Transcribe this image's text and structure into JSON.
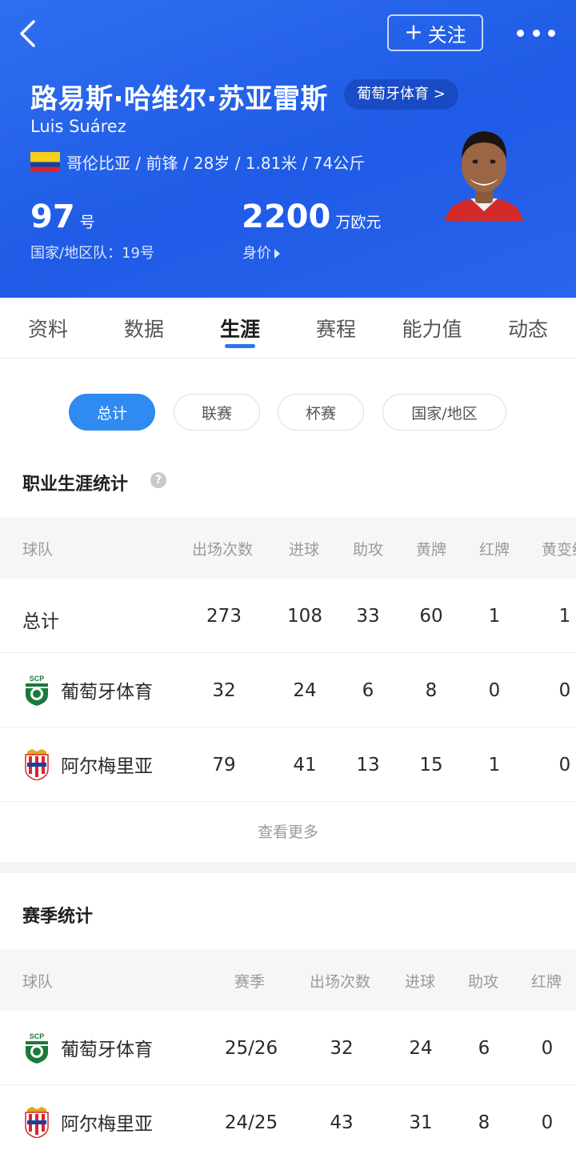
{
  "header": {
    "follow_label": "关注",
    "follow_plus": "+",
    "player_name": "路易斯·哈维尔·苏亚雷斯",
    "club_pill": "葡萄牙体育 >",
    "name_en": "Luis Suárez",
    "info": "哥伦比亚 / 前锋 / 28岁 / 1.81米 / 74公斤",
    "shirt_number": "97",
    "shirt_unit": "号",
    "national_team": "国家/地区队：19号",
    "market_value": "2200",
    "market_value_unit": "万欧元",
    "market_value_label": "身价",
    "colors": {
      "hero_blue": "#2563eb",
      "flag_yellow": "#f7cf1a",
      "flag_blue": "#1a3f9e",
      "flag_red": "#d9252b"
    }
  },
  "tabs": [
    {
      "label": "资料",
      "active": false
    },
    {
      "label": "数据",
      "active": false
    },
    {
      "label": "生涯",
      "active": true
    },
    {
      "label": "赛程",
      "active": false
    },
    {
      "label": "能力值",
      "active": false
    },
    {
      "label": "动态",
      "active": false
    }
  ],
  "filters": [
    {
      "label": "总计",
      "active": true
    },
    {
      "label": "联赛",
      "active": false
    },
    {
      "label": "杯赛",
      "active": false
    },
    {
      "label": "国家/地区",
      "active": false
    }
  ],
  "career": {
    "title": "职业生涯统计",
    "help": "?",
    "columns": [
      "球队",
      "出场次数",
      "进球",
      "助攻",
      "黄牌",
      "红牌",
      "黄变红"
    ],
    "rows": [
      {
        "team": "总计",
        "badge": "",
        "apps": "273",
        "goals": "108",
        "assists": "33",
        "yellow": "60",
        "red": "1",
        "yellow_red": "1"
      },
      {
        "team": "葡萄牙体育",
        "badge": "sporting-badge-icon",
        "apps": "32",
        "goals": "24",
        "assists": "6",
        "yellow": "8",
        "red": "0",
        "yellow_red": "0"
      },
      {
        "team": "阿尔梅里亚",
        "badge": "almeria-badge-icon",
        "apps": "79",
        "goals": "41",
        "assists": "13",
        "yellow": "15",
        "red": "1",
        "yellow_red": "0"
      }
    ],
    "more_label": "查看更多"
  },
  "season": {
    "title": "赛季统计",
    "columns": [
      "球队",
      "赛季",
      "出场次数",
      "进球",
      "助攻",
      "红牌"
    ],
    "rows": [
      {
        "team": "葡萄牙体育",
        "badge": "sporting-badge-icon",
        "season": "25/26",
        "apps": "32",
        "goals": "24",
        "assists": "6",
        "red": "0"
      },
      {
        "team": "阿尔梅里亚",
        "badge": "almeria-badge-icon",
        "season": "24/25",
        "apps": "43",
        "goals": "31",
        "assists": "8",
        "red": "0"
      }
    ]
  }
}
